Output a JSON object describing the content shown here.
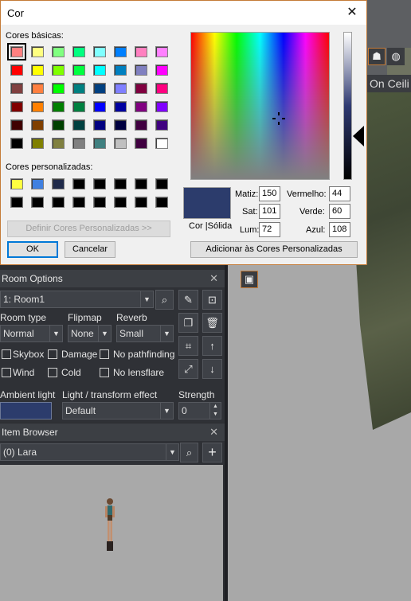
{
  "dialog": {
    "title": "Cor",
    "basic_label": "Cores básicas:",
    "custom_label": "Cores personalizadas:",
    "define_custom": "Definir Cores Personalizadas >>",
    "ok": "OK",
    "cancel": "Cancelar",
    "add_custom": "Adicionar às Cores Personalizadas",
    "color_solid_label": "Cor |Sólida",
    "hue_label": "Matiz:",
    "hue": "150",
    "sat_label": "Sat:",
    "sat": "101",
    "lum_label": "Lum:",
    "lum": "72",
    "red_label": "Vermelho:",
    "red": "44",
    "green_label": "Verde:",
    "green": "60",
    "blue_label": "Azul:",
    "blue": "108",
    "selected_color": "#2c3c6c",
    "basic_colors": [
      [
        "#ff8080",
        "#ffff80",
        "#80ff80",
        "#00ff80",
        "#80ffff",
        "#0080ff",
        "#ff80c0",
        "#ff80ff"
      ],
      [
        "#ff0000",
        "#ffff00",
        "#80ff00",
        "#00ff40",
        "#00ffff",
        "#0080c0",
        "#8080c0",
        "#ff00ff"
      ],
      [
        "#804040",
        "#ff8040",
        "#00ff00",
        "#008080",
        "#004080",
        "#8080ff",
        "#800040",
        "#ff0080"
      ],
      [
        "#800000",
        "#ff8000",
        "#008000",
        "#008040",
        "#0000ff",
        "#0000a0",
        "#800080",
        "#8000ff"
      ],
      [
        "#400000",
        "#804000",
        "#004000",
        "#004040",
        "#000080",
        "#000040",
        "#400040",
        "#400080"
      ],
      [
        "#000000",
        "#808000",
        "#808040",
        "#808080",
        "#408080",
        "#c0c0c0",
        "#400040",
        "#ffffff"
      ]
    ],
    "custom_colors": [
      [
        "#ffff40",
        "#4080e0",
        "#1f2a4a",
        "#000000",
        "#000000",
        "#000000",
        "#000000",
        "#000000"
      ],
      [
        "#000000",
        "#000000",
        "#000000",
        "#000000",
        "#000000",
        "#000000",
        "#000000",
        "#000000"
      ]
    ]
  },
  "viewport": {
    "room_label": "On Ceili"
  },
  "room_options": {
    "title": "Room Options",
    "room": "1: Room1",
    "room_type_label": "Room type",
    "room_type": "Normal",
    "flipmap_label": "Flipmap",
    "flipmap": "None",
    "reverb_label": "Reverb",
    "reverb": "Small",
    "skybox": "Skybox",
    "damage": "Damage",
    "no_pathfinding": "No pathfinding",
    "wind": "Wind",
    "cold": "Cold",
    "no_lensflare": "No lensflare",
    "ambient_label": "Ambient light",
    "ambient_color": "#2c3c6c",
    "light_effect_label": "Light / transform effect",
    "light_effect": "Default",
    "strength_label": "Strength",
    "strength": "0"
  },
  "item_browser": {
    "title": "Item Browser",
    "item": "(0) Lara"
  }
}
